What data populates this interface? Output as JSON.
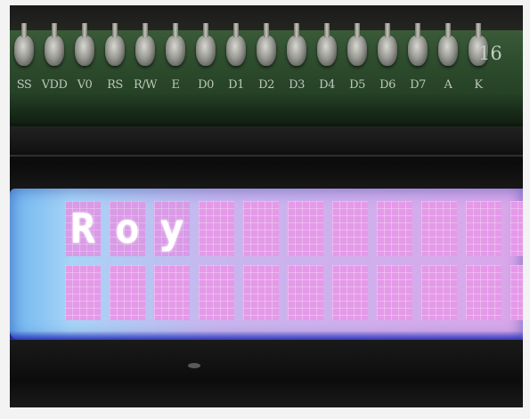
{
  "pcb": {
    "pin_labels": [
      "SS",
      "VDD",
      "V0",
      "RS",
      "R/W",
      "E",
      "D0",
      "D1",
      "D2",
      "D3",
      "D4",
      "D5",
      "D6",
      "D7",
      "A",
      "K"
    ],
    "pin_number": "16"
  },
  "lcd": {
    "row1": [
      "R",
      "o",
      "y",
      "",
      "",
      "",
      "",
      "",
      "",
      "",
      "",
      ""
    ],
    "row2": [
      "",
      "",
      "",
      "",
      "",
      "",
      "",
      "",
      "",
      "",
      "",
      ""
    ],
    "backlight_color": "#d9a7ea",
    "text_color": "#ffffff"
  }
}
